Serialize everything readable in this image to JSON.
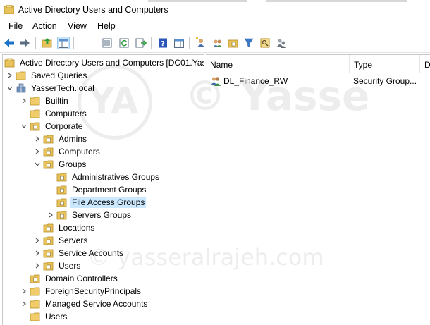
{
  "window": {
    "title": "Active Directory Users and Computers"
  },
  "menu": {
    "items": [
      "File",
      "Action",
      "View",
      "Help"
    ]
  },
  "toolbar": {
    "buttons": [
      "back-icon",
      "forward-icon",
      "up-folder-icon",
      "show-console-tree-icon",
      "properties-icon",
      "refresh-icon",
      "export-list-icon",
      "help-icon",
      "show-action-pane-icon",
      "new-user-icon",
      "new-group-icon",
      "new-ou-icon",
      "filter-icon",
      "find-icon",
      "delegate-icon"
    ]
  },
  "tree": {
    "root": "Active Directory Users and Computers [DC01.Yass",
    "items": [
      {
        "label": "Saved Queries",
        "level": 1,
        "expander": "collapsed"
      },
      {
        "label": "YasserTech.local",
        "level": 1,
        "expander": "expanded"
      },
      {
        "label": "Builtin",
        "level": 2,
        "expander": "collapsed"
      },
      {
        "label": "Computers",
        "level": 2,
        "expander": "none"
      },
      {
        "label": "Corporate",
        "level": 2,
        "expander": "expanded"
      },
      {
        "label": "Admins",
        "level": 3,
        "expander": "collapsed"
      },
      {
        "label": "Computers",
        "level": 3,
        "expander": "collapsed"
      },
      {
        "label": "Groups",
        "level": 3,
        "expander": "expanded"
      },
      {
        "label": "Administratives Groups",
        "level": 4,
        "expander": "none"
      },
      {
        "label": "Department Groups",
        "level": 4,
        "expander": "none"
      },
      {
        "label": "File Access Groups",
        "level": 4,
        "expander": "none",
        "selected": true
      },
      {
        "label": "Servers Groups",
        "level": 4,
        "expander": "collapsed"
      },
      {
        "label": "Locations",
        "level": 3,
        "expander": "none"
      },
      {
        "label": "Servers",
        "level": 3,
        "expander": "collapsed"
      },
      {
        "label": "Service Accounts",
        "level": 3,
        "expander": "collapsed"
      },
      {
        "label": "Users",
        "level": 3,
        "expander": "collapsed"
      },
      {
        "label": "Domain Controllers",
        "level": 2,
        "expander": "none"
      },
      {
        "label": "ForeignSecurityPrincipals",
        "level": 2,
        "expander": "collapsed"
      },
      {
        "label": "Managed Service Accounts",
        "level": 2,
        "expander": "collapsed"
      },
      {
        "label": "Users",
        "level": 2,
        "expander": "none"
      }
    ]
  },
  "list": {
    "columns": [
      "Name",
      "Type",
      "D"
    ],
    "rows": [
      {
        "name": "DL_Finance_RW",
        "type": "Security Group..."
      }
    ]
  },
  "watermark": {
    "line1": "© Yasse",
    "line2": "© yasseralrajeh.com",
    "logo": "YA"
  },
  "colors": {
    "selection": "#cce8ff",
    "folder": "#e8c25a",
    "accent": "#1a73c9"
  }
}
